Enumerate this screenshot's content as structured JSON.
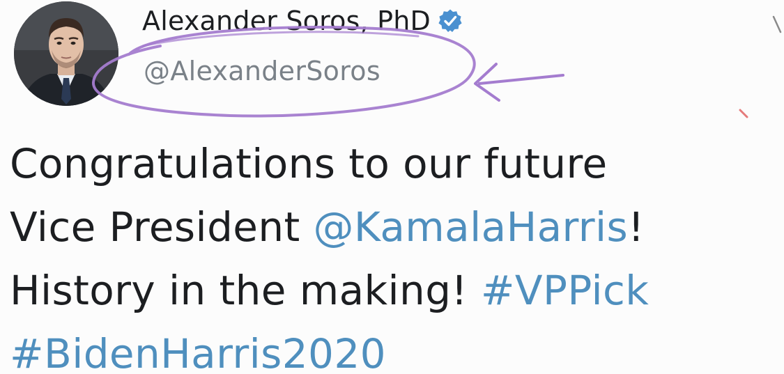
{
  "author": {
    "display_name": "Alexander Soros, PhD",
    "handle": "@AlexanderSoros",
    "verified_icon": "verified-badge-icon",
    "avatar_icon": "profile-photo"
  },
  "tweet": {
    "line1": {
      "text": "Congratulations to our future"
    },
    "line2": {
      "text_before": "Vice President ",
      "mention": "@KamalaHarris",
      "text_after": "!"
    },
    "line3": {
      "text_before": "History in the making! ",
      "hashtag": "#VPPick"
    },
    "line4": {
      "hashtag": "#BidenHarris2020"
    }
  },
  "colors": {
    "link": "#4f8fbe",
    "verified_badge": "#1d9bf0",
    "annotation_purple": "#9b6fc4",
    "handle_gray": "#7a8188"
  }
}
